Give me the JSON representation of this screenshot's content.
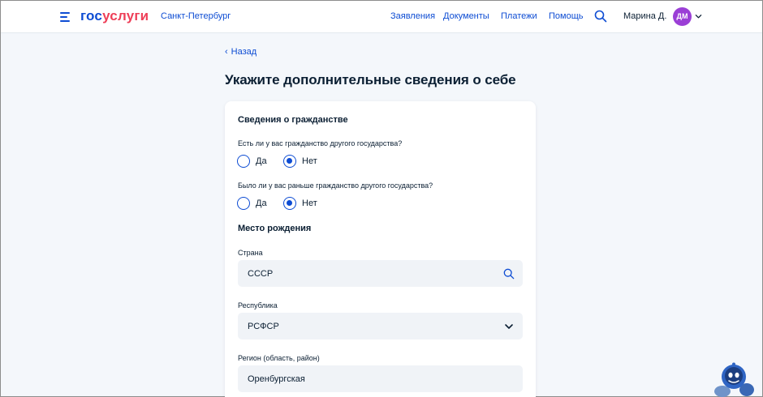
{
  "header": {
    "logo_part1": "гос",
    "logo_part2": "услуги",
    "city": "Санкт-Петербург",
    "nav": [
      "Заявления",
      "Документы",
      "Платежи",
      "Помощь"
    ],
    "user_name": "Марина Д.",
    "avatar_initials": "ДМ"
  },
  "back_label": "Назад",
  "page_title": "Укажите дополнительные сведения о себе",
  "citizenship": {
    "title": "Сведения о гражданстве",
    "q1": {
      "question": "Есть ли у вас гражданство другого государства?",
      "options": [
        "Да",
        "Нет"
      ],
      "selected": "Нет"
    },
    "q2": {
      "question": "Было ли у вас раньше гражданство другого государства?",
      "options": [
        "Да",
        "Нет"
      ],
      "selected": "Нет"
    }
  },
  "birthplace": {
    "title": "Место рождения",
    "country": {
      "label": "Страна",
      "value": "СССР"
    },
    "republic": {
      "label": "Республика",
      "value": "РСФСР"
    },
    "region": {
      "label": "Регион (область, район)",
      "value": "Оренбургская"
    }
  },
  "colors": {
    "accent": "#0d4cd3",
    "logo_red": "#ee3f58",
    "avatar": "#9b3fd6",
    "background": "#f4f7fb",
    "field_bg": "#f0f3f7"
  },
  "icons": {
    "menu": "burger-menu-icon",
    "search": "search-icon",
    "dropdown": "chevron-down-icon",
    "back": "chevron-left-icon",
    "assistant": "robot-assistant-icon"
  }
}
